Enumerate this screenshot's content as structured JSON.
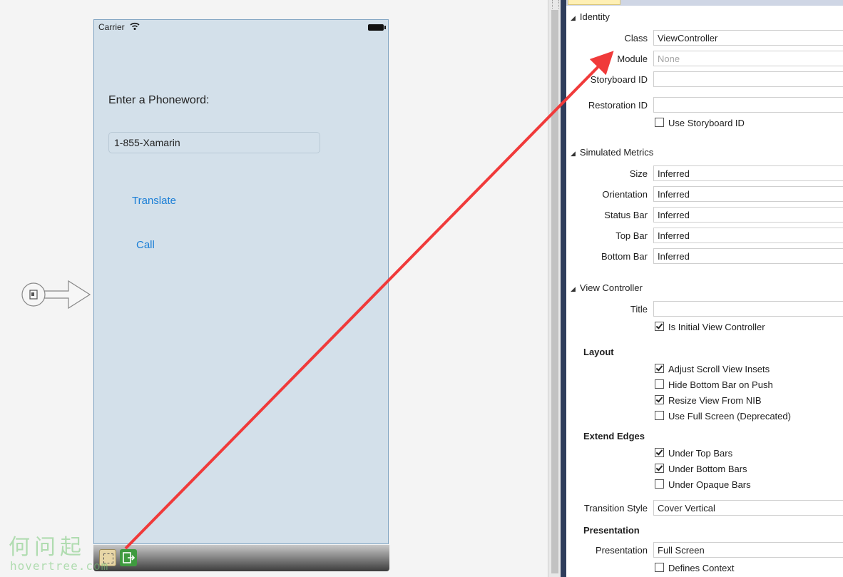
{
  "phone": {
    "carrier": "Carrier",
    "prompt_label": "Enter a Phoneword:",
    "phone_value": "1-855-Xamarin",
    "translate_label": "Translate",
    "call_label": "Call"
  },
  "watermark": {
    "text": "何问起",
    "sub": "hovertree.com"
  },
  "properties": {
    "identity": {
      "header": "Identity",
      "class_label": "Class",
      "class_value": "ViewController",
      "module_label": "Module",
      "module_placeholder": "None",
      "storyboard_id_label": "Storyboard ID",
      "restoration_id_label": "Restoration ID",
      "use_storyboard_id": {
        "label": "Use Storyboard ID",
        "checked": false
      }
    },
    "simulated_metrics": {
      "header": "Simulated Metrics",
      "rows": [
        {
          "label": "Size",
          "value": "Inferred"
        },
        {
          "label": "Orientation",
          "value": "Inferred"
        },
        {
          "label": "Status Bar",
          "value": "Inferred"
        },
        {
          "label": "Top Bar",
          "value": "Inferred"
        },
        {
          "label": "Bottom Bar",
          "value": "Inferred"
        }
      ]
    },
    "view_controller": {
      "header": "View Controller",
      "title_label": "Title",
      "is_initial": {
        "label": "Is Initial View Controller",
        "checked": true
      },
      "layout_header": "Layout",
      "layout": [
        {
          "label": "Adjust Scroll View Insets",
          "checked": true
        },
        {
          "label": "Hide Bottom Bar on Push",
          "checked": false
        },
        {
          "label": "Resize View From NIB",
          "checked": true
        },
        {
          "label": "Use Full Screen (Deprecated)",
          "checked": false
        }
      ],
      "extend_header": "Extend Edges",
      "extend": [
        {
          "label": "Under Top Bars",
          "checked": true
        },
        {
          "label": "Under Bottom Bars",
          "checked": true
        },
        {
          "label": "Under Opaque Bars",
          "checked": false
        }
      ],
      "transition_label": "Transition Style",
      "transition_value": "Cover Vertical",
      "presentation_header": "Presentation",
      "presentation_label": "Presentation",
      "presentation_value": "Full Screen",
      "defines_context": {
        "label": "Defines Context",
        "checked": false
      }
    }
  },
  "colors": {
    "annotation_arrow": "#f03a3a",
    "ios_tint": "#1a7ed6",
    "scene_background": "#d3e0ea",
    "panel_divider": "#2f3e5c"
  }
}
